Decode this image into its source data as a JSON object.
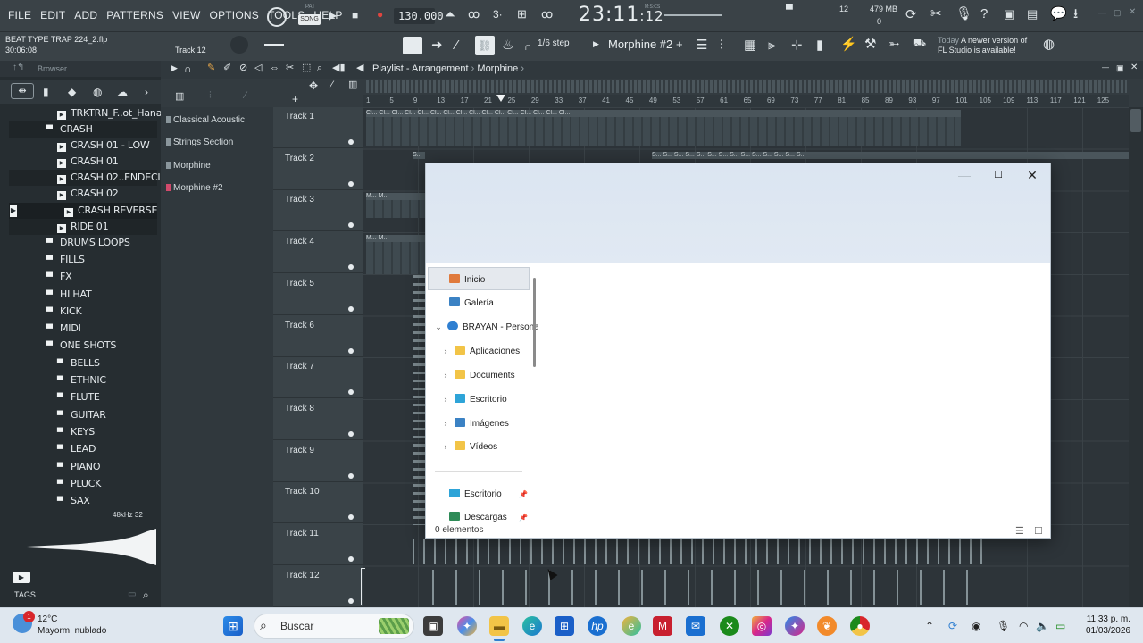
{
  "app": {
    "menu": [
      "FILE",
      "EDIT",
      "ADD",
      "PATTERNS",
      "VIEW",
      "OPTIONS",
      "TOOLS",
      "HELP"
    ],
    "pat_label": "PAT",
    "song_label": "SONG",
    "tempo": "130.000",
    "time_main": "23:11",
    "time_sub": ":12",
    "time_unit": "M:S:CS",
    "cpu_count": "12",
    "memory": "479 MB",
    "memory_sub": "0",
    "project_name": "BEAT TYPE TRAP 224_2.flp",
    "project_time": "30:06:08",
    "current_track": "Track 12",
    "snap": "1/6 step",
    "pattern": "Morphine #2",
    "news_date": "Today",
    "news_text_1": "A newer version of",
    "news_text_2": "FL Studio is available!"
  },
  "browser": {
    "title": "Browser",
    "items": [
      {
        "label": "TRKTRN_F..ot_Hana_C",
        "type": "file",
        "indent": 1
      },
      {
        "label": "CRASH",
        "type": "folder",
        "indent": 0
      },
      {
        "label": "CRASH 01 - LOW",
        "type": "file",
        "indent": 1
      },
      {
        "label": "CRASH 01",
        "type": "file",
        "indent": 1
      },
      {
        "label": "CRASH 02..ENDECIDO",
        "type": "file",
        "indent": 1
      },
      {
        "label": "CRASH 02",
        "type": "file",
        "indent": 1
      },
      {
        "label": "CRASH REVERSE",
        "type": "file",
        "indent": 2
      },
      {
        "label": "RIDE 01",
        "type": "file",
        "indent": 1
      },
      {
        "label": "DRUMS LOOPS",
        "type": "folder",
        "indent": 0
      },
      {
        "label": "FILLS",
        "type": "folder",
        "indent": 0
      },
      {
        "label": "FX",
        "type": "folder",
        "indent": 0
      },
      {
        "label": "HI HAT",
        "type": "folder",
        "indent": 0
      },
      {
        "label": "KICK",
        "type": "folder",
        "indent": 0
      },
      {
        "label": "MIDI",
        "type": "folder",
        "indent": 0
      },
      {
        "label": "ONE SHOTS",
        "type": "folder",
        "indent": 0
      },
      {
        "label": "BELLS",
        "type": "folder",
        "indent": 1
      },
      {
        "label": "ETHNIC",
        "type": "folder",
        "indent": 1
      },
      {
        "label": "FLUTE",
        "type": "folder",
        "indent": 1
      },
      {
        "label": "GUITAR",
        "type": "folder",
        "indent": 1
      },
      {
        "label": "KEYS",
        "type": "folder",
        "indent": 1
      },
      {
        "label": "LEAD",
        "type": "folder",
        "indent": 1
      },
      {
        "label": "PIANO",
        "type": "folder",
        "indent": 1
      },
      {
        "label": "PLUCK",
        "type": "folder",
        "indent": 1
      },
      {
        "label": "SAX",
        "type": "folder",
        "indent": 1
      }
    ],
    "wave_info": "48kHz 32",
    "tags_label": "TAGS"
  },
  "picker": {
    "items": [
      {
        "label": "Classical Acoustic",
        "color": "#8a969c"
      },
      {
        "label": "Strings Section",
        "color": "#8a969c"
      },
      {
        "label": "Morphine",
        "color": "#8a969c"
      },
      {
        "label": "Morphine #2",
        "color": "#d24a6c"
      }
    ]
  },
  "playlist": {
    "title": "Playlist - Arrangement",
    "pattern": "Morphine",
    "ruler": [
      "1",
      "5",
      "9",
      "13",
      "17",
      "21",
      "25",
      "29",
      "33",
      "37",
      "41",
      "45",
      "49",
      "53",
      "57",
      "61",
      "65",
      "69",
      "73",
      "77",
      "81",
      "85",
      "89",
      "93",
      "97",
      "101",
      "105",
      "109",
      "113",
      "117",
      "121",
      "125"
    ],
    "tracks": [
      "Track 1",
      "Track 2",
      "Track 3",
      "Track 4",
      "Track 5",
      "Track 6",
      "Track 7",
      "Track 8",
      "Track 9",
      "Track 10",
      "Track 11",
      "Track 12"
    ]
  },
  "dialog": {
    "nav": [
      {
        "label": "Inicio",
        "icon": "home-icon",
        "color": "#e07a3c",
        "indent": 0,
        "chevron": false,
        "pinned": false
      },
      {
        "label": "Galería",
        "icon": "gallery-icon",
        "color": "#3b82c4",
        "indent": 0,
        "chevron": false,
        "pinned": false
      },
      {
        "label": "BRAYAN - Personal",
        "icon": "onedrive-icon",
        "color": "#2f7fd1",
        "indent": 0,
        "chevron": true,
        "expanded": true,
        "pinned": false
      },
      {
        "label": "Aplicaciones",
        "icon": "folder-icon",
        "color": "#f2c447",
        "indent": 1,
        "chevron": true,
        "pinned": false
      },
      {
        "label": "Documents",
        "icon": "folder-icon",
        "color": "#f2c447",
        "indent": 1,
        "chevron": true,
        "pinned": false
      },
      {
        "label": "Escritorio",
        "icon": "desktop-icon",
        "color": "#2ea4d8",
        "indent": 1,
        "chevron": true,
        "pinned": false
      },
      {
        "label": "Imágenes",
        "icon": "images-icon",
        "color": "#3b82c4",
        "indent": 1,
        "chevron": true,
        "pinned": false
      },
      {
        "label": "Vídeos",
        "icon": "folder-icon",
        "color": "#f2c447",
        "indent": 1,
        "chevron": true,
        "pinned": false
      },
      {
        "label": "Escritorio",
        "icon": "desktop-icon",
        "color": "#2ea4d8",
        "indent": 0,
        "chevron": false,
        "pinned": true
      },
      {
        "label": "Descargas",
        "icon": "download-icon",
        "color": "#2e8b57",
        "indent": 0,
        "chevron": false,
        "pinned": true
      }
    ],
    "status": "0 elementos"
  },
  "taskbar": {
    "weather_temp": "12°C",
    "weather_desc": "Mayorm. nublado",
    "weather_badge": "1",
    "search_placeholder": "Buscar",
    "time": "11:33 p. m.",
    "date": "01/03/2026"
  }
}
